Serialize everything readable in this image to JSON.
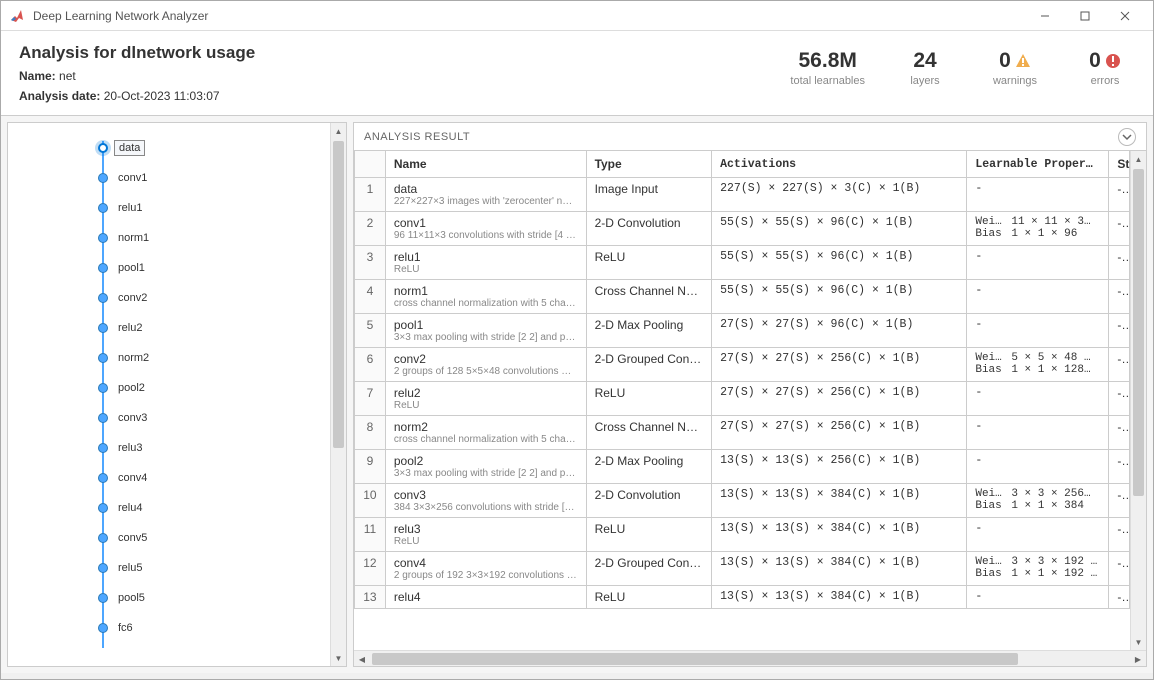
{
  "window": {
    "title": "Deep Learning Network Analyzer"
  },
  "header": {
    "title": "Analysis for dlnetwork usage",
    "name_label": "Name:",
    "name_value": "net",
    "date_label": "Analysis date:",
    "date_value": "20-Oct-2023 11:03:07",
    "stats": {
      "learnables": {
        "value": "56.8M",
        "label": "total learnables"
      },
      "layers": {
        "value": "24",
        "label": "layers"
      },
      "warnings": {
        "value": "0",
        "label": "warnings"
      },
      "errors": {
        "value": "0",
        "label": "errors"
      }
    }
  },
  "graph": {
    "nodes": [
      {
        "name": "data",
        "selected": true
      },
      {
        "name": "conv1"
      },
      {
        "name": "relu1"
      },
      {
        "name": "norm1"
      },
      {
        "name": "pool1"
      },
      {
        "name": "conv2"
      },
      {
        "name": "relu2"
      },
      {
        "name": "norm2"
      },
      {
        "name": "pool2"
      },
      {
        "name": "conv3"
      },
      {
        "name": "relu3"
      },
      {
        "name": "conv4"
      },
      {
        "name": "relu4"
      },
      {
        "name": "conv5"
      },
      {
        "name": "relu5"
      },
      {
        "name": "pool5"
      },
      {
        "name": "fc6"
      }
    ]
  },
  "result": {
    "heading": "ANALYSIS RESULT",
    "columns": {
      "name": "Name",
      "type": "Type",
      "activations": "Activations",
      "learnable": "Learnable Proper…",
      "st": "St"
    },
    "rows": [
      {
        "idx": "1",
        "name": "data",
        "sub": "227×227×3 images with 'zerocenter' nor…",
        "type": "Image Input",
        "act": "227(S) × 227(S) × 3(C) × 1(B)",
        "learn": [],
        "st": "-"
      },
      {
        "idx": "2",
        "name": "conv1",
        "sub": "96 11×11×3 convolutions with stride [4 4…",
        "type": "2-D Convolution",
        "act": "55(S) × 55(S) × 96(C) × 1(B)",
        "learn": [
          [
            "Weig…",
            "11 × 11 × 3…"
          ],
          [
            "Bias",
            "1 × 1 × 96"
          ]
        ],
        "st": "-"
      },
      {
        "idx": "3",
        "name": "relu1",
        "sub": "ReLU",
        "type": "ReLU",
        "act": "55(S) × 55(S) × 96(C) × 1(B)",
        "learn": [],
        "st": "-"
      },
      {
        "idx": "4",
        "name": "norm1",
        "sub": "cross channel normalization with 5 chann…",
        "type": "Cross Channel Norm…",
        "act": "55(S) × 55(S) × 96(C) × 1(B)",
        "learn": [],
        "st": "-"
      },
      {
        "idx": "5",
        "name": "pool1",
        "sub": "3×3 max pooling with stride [2 2] and pa…",
        "type": "2-D Max Pooling",
        "act": "27(S) × 27(S) × 96(C) × 1(B)",
        "learn": [],
        "st": "-"
      },
      {
        "idx": "6",
        "name": "conv2",
        "sub": "2 groups of 128 5×5×48 convolutions wi…",
        "type": "2-D Grouped Convo…",
        "act": "27(S) × 27(S) × 256(C) × 1(B)",
        "learn": [
          [
            "Wei…",
            "5 × 5 × 48 …"
          ],
          [
            "Bias",
            "1 × 1 × 128…"
          ]
        ],
        "st": "-"
      },
      {
        "idx": "7",
        "name": "relu2",
        "sub": "ReLU",
        "type": "ReLU",
        "act": "27(S) × 27(S) × 256(C) × 1(B)",
        "learn": [],
        "st": "-"
      },
      {
        "idx": "8",
        "name": "norm2",
        "sub": "cross channel normalization with 5 chann…",
        "type": "Cross Channel Norm…",
        "act": "27(S) × 27(S) × 256(C) × 1(B)",
        "learn": [],
        "st": "-"
      },
      {
        "idx": "9",
        "name": "pool2",
        "sub": "3×3 max pooling with stride [2 2] and pa…",
        "type": "2-D Max Pooling",
        "act": "13(S) × 13(S) × 256(C) × 1(B)",
        "learn": [],
        "st": "-"
      },
      {
        "idx": "10",
        "name": "conv3",
        "sub": "384 3×3×256 convolutions with stride [1 …",
        "type": "2-D Convolution",
        "act": "13(S) × 13(S) × 384(C) × 1(B)",
        "learn": [
          [
            "Wei…",
            "3 × 3 × 256…"
          ],
          [
            "Bias",
            "1 × 1 × 384"
          ]
        ],
        "st": "-"
      },
      {
        "idx": "11",
        "name": "relu3",
        "sub": "ReLU",
        "type": "ReLU",
        "act": "13(S) × 13(S) × 384(C) × 1(B)",
        "learn": [],
        "st": "-"
      },
      {
        "idx": "12",
        "name": "conv4",
        "sub": "2 groups of 192 3×3×192 convolutions …",
        "type": "2-D Grouped Convo…",
        "act": "13(S) × 13(S) × 384(C) × 1(B)",
        "learn": [
          [
            "Wei…",
            "3 × 3 × 192 …"
          ],
          [
            "Bias",
            "1 × 1 × 192 …"
          ]
        ],
        "st": "-"
      },
      {
        "idx": "13",
        "name": "relu4",
        "sub": "",
        "type": "ReLU",
        "act": "13(S) × 13(S) × 384(C) × 1(B)",
        "learn": [],
        "st": "-"
      }
    ]
  }
}
